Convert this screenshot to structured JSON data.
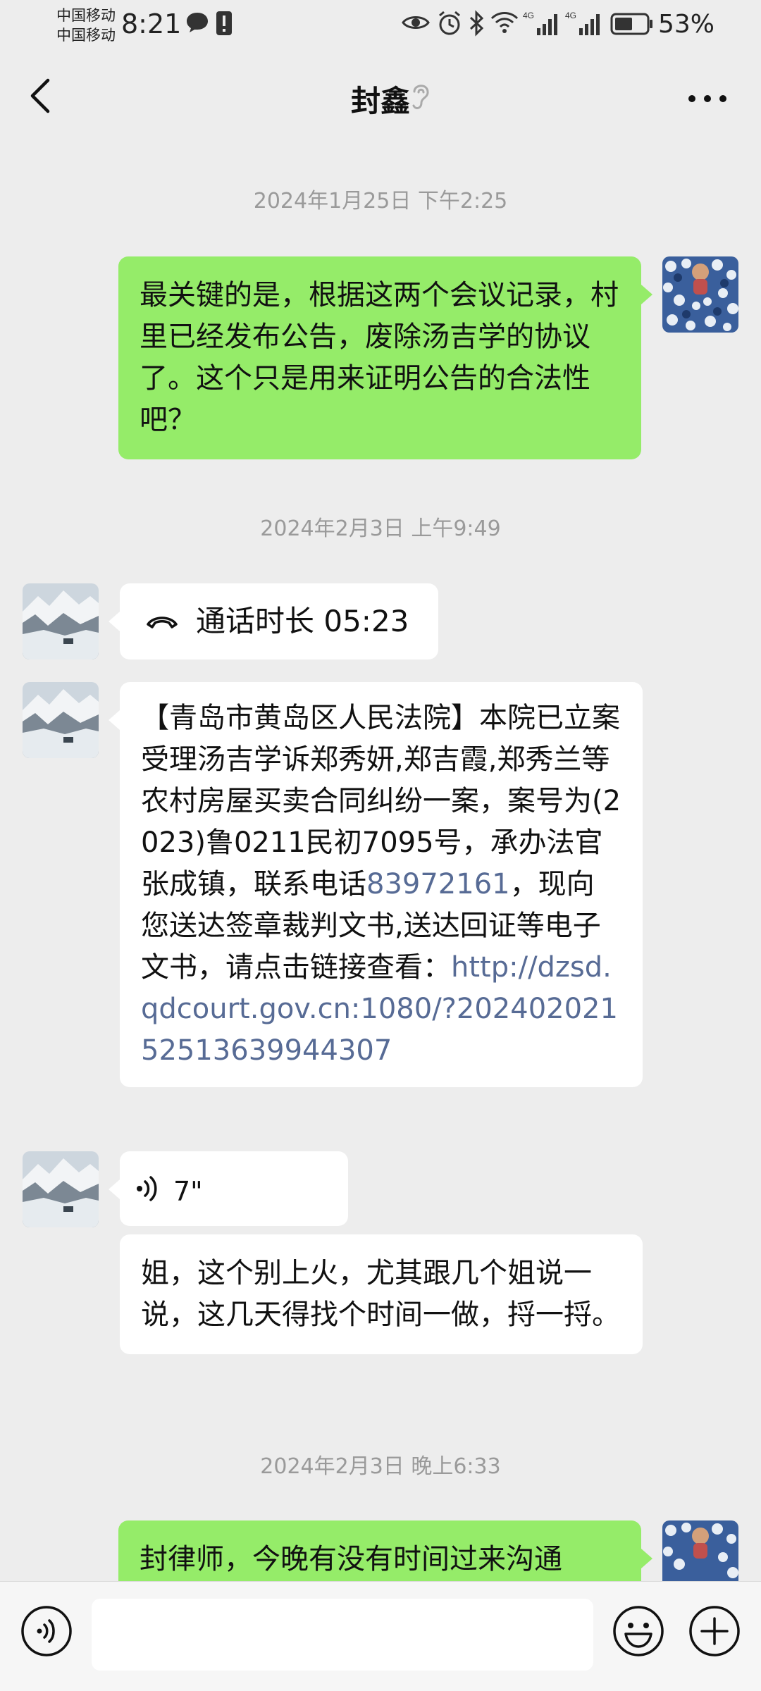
{
  "status_bar": {
    "carrier_1": "中国移动",
    "carrier_2": "中国移动",
    "time": "8:21",
    "battery": "53%"
  },
  "header": {
    "title": "封鑫"
  },
  "messages": [
    {
      "type": "timestamp",
      "text": "2024年1月25日 下午2:25"
    },
    {
      "type": "text",
      "direction": "out",
      "text": "最关键的是，根据这两个会议记录，村里已经发布公告，废除汤吉学的协议了。这个只是用来证明公告的合法性吧？"
    },
    {
      "type": "timestamp",
      "text": "2024年2月3日 上午9:49"
    },
    {
      "type": "call",
      "direction": "in",
      "text": "通话时长 05:23"
    },
    {
      "type": "text",
      "direction": "in",
      "text_part1": "【青岛市黄岛区人民法院】本院已立案受理汤吉学诉郑秀妍,郑吉霞,郑秀兰等农村房屋买卖合同纠纷一案，案号为(2023)鲁0211民初7095号，承办法官张成镇，联系电话",
      "phone": "83972161",
      "text_part2": "，现向您送达签章裁判文书,送达回证等电子文书，请点击链接查看：",
      "url": "http://dzsd.qdcourt.gov.cn:1080/?20240202152513639944307"
    },
    {
      "type": "voice",
      "direction": "in",
      "duration": "7\""
    },
    {
      "type": "text",
      "direction": "in",
      "text": "姐，这个别上火，尤其跟几个姐说一说，这几天得找个时间一做，捋一捋。"
    },
    {
      "type": "timestamp",
      "text": "2024年2月3日 晚上6:33"
    },
    {
      "type": "text",
      "direction": "out",
      "text": "封律师，今晚有没有时间过来沟通"
    }
  ],
  "colors": {
    "background": "#ededed",
    "outgoing_bubble": "#95ec69",
    "incoming_bubble": "#ffffff",
    "link": "#576b95",
    "timestamp": "#9a9a9a"
  },
  "icons": {
    "back": "chevron-left-icon",
    "ear": "earpiece-mode-icon",
    "more": "more-dots-icon",
    "call": "phone-hangup-icon",
    "voice": "voice-wave-icon",
    "voice_mode": "voice-input-icon",
    "emoji": "emoji-icon",
    "plus": "plus-icon"
  }
}
